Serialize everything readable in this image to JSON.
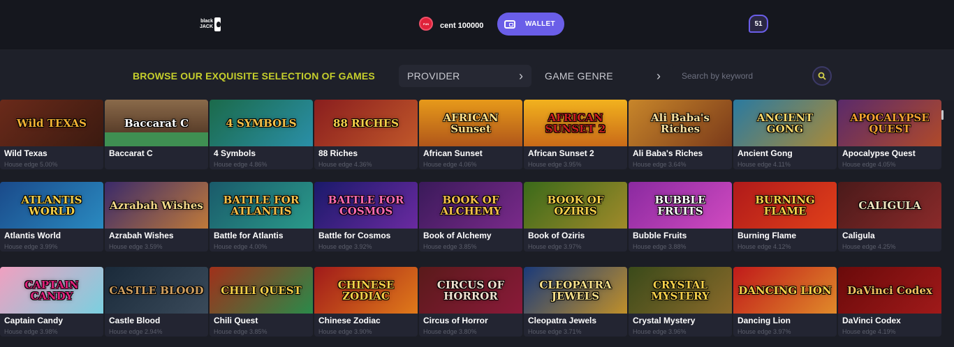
{
  "header": {
    "logo_text": "black JACK",
    "coin_label": "FUN",
    "balance": "cent 100000",
    "wallet_label": "WALLET",
    "notification_count": "51"
  },
  "browse": {
    "title": "BROWSE OUR EXQUISITE SELECTION OF GAMES",
    "provider_label": "PROVIDER",
    "genre_label": "GAME GENRE",
    "search_placeholder": "Search by keyword"
  },
  "colors": {
    "accent": "#6a5ee8",
    "title_yellow": "#c6cf2c",
    "background": "#1b1d25"
  },
  "games": [
    {
      "name": "Wild Texas",
      "edge": "House edge 5.00%",
      "art": "Wild TEXAS",
      "bg": "linear-gradient(135deg,#6a2a1a,#3b1a10)",
      "fg": "#f2b233"
    },
    {
      "name": "Baccarat C",
      "edge": "",
      "art": "Baccarat C",
      "bg": "linear-gradient(180deg,#8a6a4a,#5a3e2a 70%,#3f8f52 70%)",
      "fg": "#ffffff"
    },
    {
      "name": "4 Symbols",
      "edge": "House edge 4.86%",
      "art": "4 SYMBOLS",
      "bg": "linear-gradient(135deg,#1b6a4a,#2a8fa8)",
      "fg": "#f5c24a"
    },
    {
      "name": "88 Riches",
      "edge": "House edge 4.36%",
      "art": "88 RICHES",
      "bg": "linear-gradient(135deg,#8a1e1e,#c0572a)",
      "fg": "#f7d049"
    },
    {
      "name": "African Sunset",
      "edge": "House edge 4.06%",
      "art": "AFRICAN Sunset",
      "bg": "linear-gradient(180deg,#e79a1a,#b0561a)",
      "fg": "#ffe08a"
    },
    {
      "name": "African Sunset 2",
      "edge": "House edge 3.95%",
      "art": "AFRICAN SUNSET 2",
      "bg": "linear-gradient(180deg,#f2b21e,#c96a18)",
      "fg": "#c81e1e"
    },
    {
      "name": "Ali Baba's Riches",
      "edge": "House edge 3.64%",
      "art": "Ali Baba's Riches",
      "bg": "linear-gradient(135deg,#c8862a,#7a3a1a)",
      "fg": "#f7e0a0"
    },
    {
      "name": "Ancient Gong",
      "edge": "House edge 4.11%",
      "art": "ANCIENT GONG",
      "bg": "linear-gradient(135deg,#2a7aa0,#a88a3a)",
      "fg": "#f5d76a"
    },
    {
      "name": "Apocalypse Quest",
      "edge": "House edge 4.05%",
      "art": "APOCALYPSE QUEST",
      "bg": "linear-gradient(135deg,#5a2a6a,#b04a2a)",
      "fg": "#f2a030"
    },
    {
      "name": "Atlantis World",
      "edge": "House edge 3.99%",
      "art": "ATLANTIS WORLD",
      "bg": "linear-gradient(135deg,#1a4a8a,#2a8ac0)",
      "fg": "#f5d04a"
    },
    {
      "name": "Azrabah Wishes",
      "edge": "House edge 3.59%",
      "art": "Azrabah Wishes",
      "bg": "linear-gradient(135deg,#3a2a6a,#c07a3a)",
      "fg": "#f5d98a"
    },
    {
      "name": "Battle for Atlantis",
      "edge": "House edge 4.00%",
      "art": "BATTLE FOR ATLANTIS",
      "bg": "linear-gradient(135deg,#1a5a6a,#2a9a8a)",
      "fg": "#f5c04a"
    },
    {
      "name": "Battle for Cosmos",
      "edge": "House edge 3.92%",
      "art": "BATTLE FOR COSMOS",
      "bg": "linear-gradient(135deg,#1a1a6a,#6a2aa0)",
      "fg": "#ff6ab0"
    },
    {
      "name": "Book of Alchemy",
      "edge": "House edge 3.85%",
      "art": "BOOK OF ALCHEMY",
      "bg": "linear-gradient(135deg,#3a1a5a,#7a2a8a)",
      "fg": "#f5c04a"
    },
    {
      "name": "Book of Oziris",
      "edge": "House edge 3.97%",
      "art": "BOOK OF OZIRIS",
      "bg": "linear-gradient(135deg,#3a6a1a,#a08a2a)",
      "fg": "#f5d04a"
    },
    {
      "name": "Bubble Fruits",
      "edge": "House edge 3.88%",
      "art": "BUBBLE FRUITS",
      "bg": "linear-gradient(135deg,#8a2aa0,#d04ac0)",
      "fg": "#ffffff"
    },
    {
      "name": "Burning Flame",
      "edge": "House edge 4.12%",
      "art": "BURNING FLAME",
      "bg": "linear-gradient(135deg,#b01a1a,#e0401a)",
      "fg": "#f7d049"
    },
    {
      "name": "Caligula",
      "edge": "House edge 4.25%",
      "art": "CALIGULA",
      "bg": "linear-gradient(135deg,#4a1a1a,#8a2a2a)",
      "fg": "#f2e6c0"
    },
    {
      "name": "Captain Candy",
      "edge": "House edge 3.98%",
      "art": "CAPTAIN CANDY",
      "bg": "linear-gradient(135deg,#f0a0c0,#7ad0e0)",
      "fg": "#e0207a"
    },
    {
      "name": "Castle Blood",
      "edge": "House edge 2.94%",
      "art": "CASTLE BLOOD",
      "bg": "linear-gradient(135deg,#1a2a3a,#3a4a5a)",
      "fg": "#d0a060"
    },
    {
      "name": "Chili Quest",
      "edge": "House edge 3.85%",
      "art": "CHILI QUEST",
      "bg": "linear-gradient(135deg,#a0301a,#2a8a4a)",
      "fg": "#f7d049"
    },
    {
      "name": "Chinese Zodiac",
      "edge": "House edge 3.90%",
      "art": "CHINESE ZODIAC",
      "bg": "linear-gradient(135deg,#a01a1a,#e07a1a)",
      "fg": "#f7d049"
    },
    {
      "name": "Circus of Horror",
      "edge": "House edge 3.80%",
      "art": "CIRCUS OF HORROR",
      "bg": "linear-gradient(135deg,#5a1a1a,#8a1a3a)",
      "fg": "#f0e0d0"
    },
    {
      "name": "Cleopatra Jewels",
      "edge": "House edge 3.71%",
      "art": "CLEOPATRA JEWELS",
      "bg": "linear-gradient(135deg,#1a3a7a,#c0902a)",
      "fg": "#f7e08a"
    },
    {
      "name": "Crystal Mystery",
      "edge": "House edge 3.96%",
      "art": "CRYSTAL MYSTERY",
      "bg": "linear-gradient(135deg,#3a4a1a,#8a6a2a)",
      "fg": "#f5d04a"
    },
    {
      "name": "Dancing Lion",
      "edge": "House edge 3.97%",
      "art": "DANCING LION",
      "bg": "linear-gradient(135deg,#c01a1a,#e08a2a)",
      "fg": "#f7d049"
    },
    {
      "name": "DaVinci Codex",
      "edge": "House edge 4.19%",
      "art": "DaVinci Codex",
      "bg": "linear-gradient(135deg,#6a0a0a,#a01a1a)",
      "fg": "#f2c060"
    }
  ]
}
